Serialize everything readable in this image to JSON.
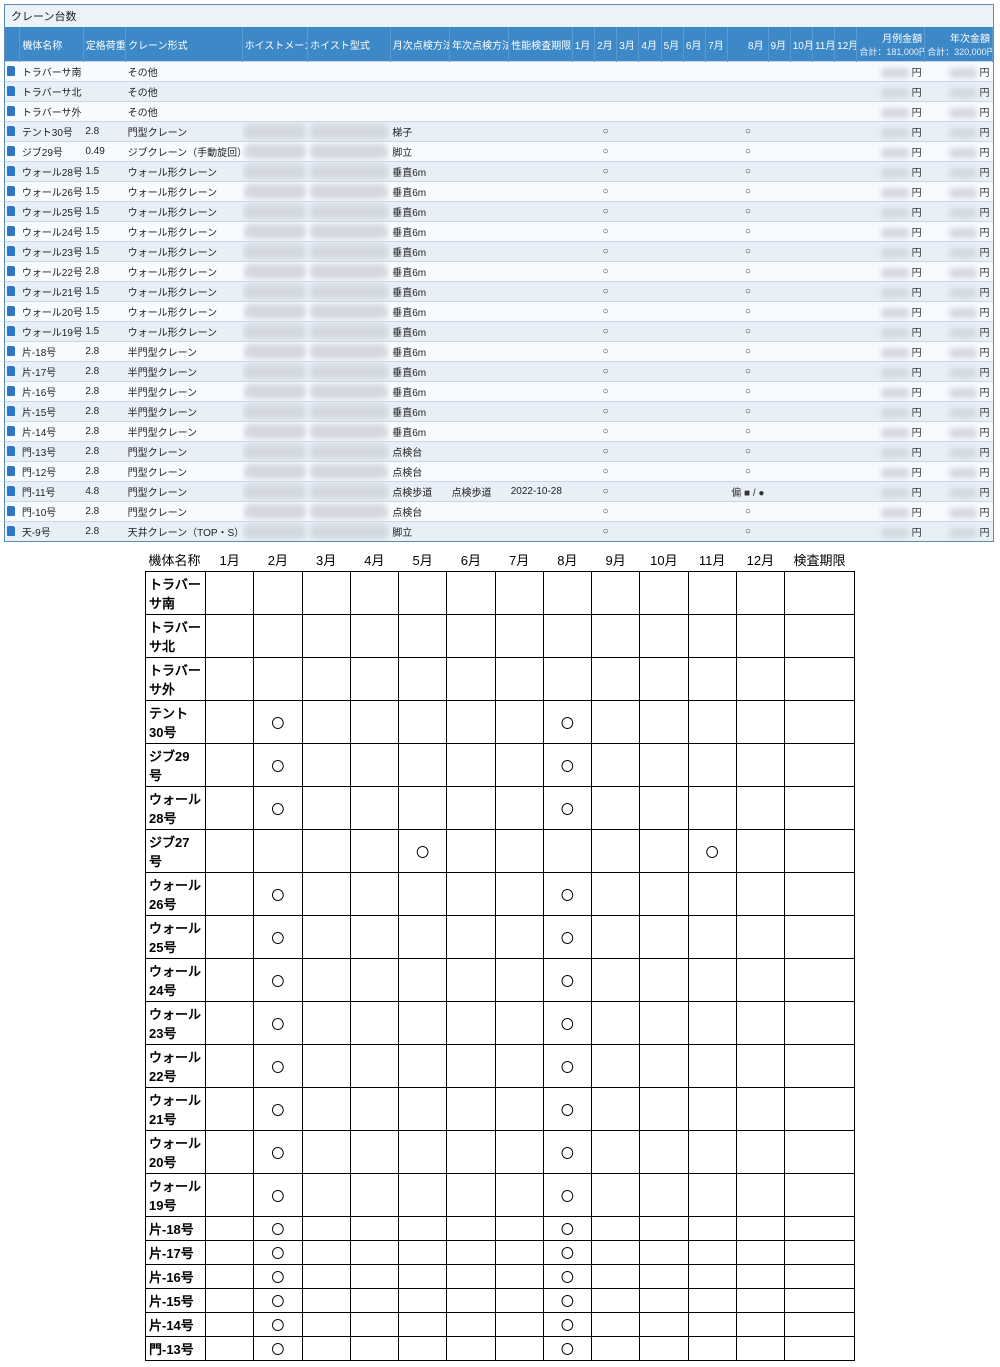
{
  "panel_title": "クレーン台数",
  "headers": {
    "name": "機体名称",
    "load": "定格荷重(t)",
    "type": "クレーン形式",
    "maker": "ホイストメーカー",
    "model": "ホイスト型式",
    "mm": "月次点検方法",
    "ym": "年次点検方法",
    "exp": "性能検査期限",
    "months": [
      "1月",
      "2月",
      "3月",
      "4月",
      "5月",
      "6月",
      "7月",
      "8月",
      "9月",
      "10月",
      "11月",
      "12月"
    ],
    "mfee": "月例金額",
    "mfee_sub": "合計：181,000円",
    "yfee": "年次金額",
    "yfee_sub": "合計：320,000円"
  },
  "yen": "円",
  "mark8": "偏 ■ / ●",
  "rows": [
    {
      "name": "トラバーサ南",
      "load": "",
      "type": "その他",
      "mm": "",
      "feb": 0,
      "aug": ""
    },
    {
      "name": "トラバーサ北",
      "load": "",
      "type": "その他",
      "mm": "",
      "feb": 0,
      "aug": ""
    },
    {
      "name": "トラバーサ外",
      "load": "",
      "type": "その他",
      "mm": "",
      "feb": 0,
      "aug": ""
    },
    {
      "name": "テント30号",
      "load": "2.8",
      "type": "門型クレーン",
      "mm": "梯子",
      "feb": 1,
      "aug": "○"
    },
    {
      "name": "ジブ29号",
      "load": "0.49",
      "type": "ジブクレーン（手動旋回）",
      "mm": "脚立",
      "feb": 1,
      "aug": "○"
    },
    {
      "name": "ウォール28号",
      "load": "1.5",
      "type": "ウォール形クレーン",
      "mm": "垂直6m",
      "feb": 1,
      "aug": "○"
    },
    {
      "name": "ウォール26号",
      "load": "1.5",
      "type": "ウォール形クレーン",
      "mm": "垂直6m",
      "feb": 1,
      "aug": "○"
    },
    {
      "name": "ウォール25号",
      "load": "1.5",
      "type": "ウォール形クレーン",
      "mm": "垂直6m",
      "feb": 1,
      "aug": "○"
    },
    {
      "name": "ウォール24号",
      "load": "1.5",
      "type": "ウォール形クレーン",
      "mm": "垂直6m",
      "feb": 1,
      "aug": "○"
    },
    {
      "name": "ウォール23号",
      "load": "1.5",
      "type": "ウォール形クレーン",
      "mm": "垂直6m",
      "feb": 1,
      "aug": "○"
    },
    {
      "name": "ウォール22号",
      "load": "2.8",
      "type": "ウォール形クレーン",
      "mm": "垂直6m",
      "feb": 1,
      "aug": "○"
    },
    {
      "name": "ウォール21号",
      "load": "1.5",
      "type": "ウォール形クレーン",
      "mm": "垂直6m",
      "feb": 1,
      "aug": "○"
    },
    {
      "name": "ウォール20号",
      "load": "1.5",
      "type": "ウォール形クレーン",
      "mm": "垂直6m",
      "feb": 1,
      "aug": "○"
    },
    {
      "name": "ウォール19号",
      "load": "1.5",
      "type": "ウォール形クレーン",
      "mm": "垂直6m",
      "feb": 1,
      "aug": "○"
    },
    {
      "name": "片-18号",
      "load": "2.8",
      "type": "半門型クレーン",
      "mm": "垂直6m",
      "feb": 1,
      "aug": "○"
    },
    {
      "name": "片-17号",
      "load": "2.8",
      "type": "半門型クレーン",
      "mm": "垂直6m",
      "feb": 1,
      "aug": "○"
    },
    {
      "name": "片-16号",
      "load": "2.8",
      "type": "半門型クレーン",
      "mm": "垂直6m",
      "feb": 1,
      "aug": "○"
    },
    {
      "name": "片-15号",
      "load": "2.8",
      "type": "半門型クレーン",
      "mm": "垂直6m",
      "feb": 1,
      "aug": "○"
    },
    {
      "name": "片-14号",
      "load": "2.8",
      "type": "半門型クレーン",
      "mm": "垂直6m",
      "feb": 1,
      "aug": "○"
    },
    {
      "name": "門-13号",
      "load": "2.8",
      "type": "門型クレーン",
      "mm": "点検台",
      "feb": 1,
      "aug": "○"
    },
    {
      "name": "門-12号",
      "load": "2.8",
      "type": "門型クレーン",
      "mm": "点検台",
      "feb": 1,
      "aug": "○"
    },
    {
      "name": "門-11号",
      "load": "4.8",
      "type": "門型クレーン",
      "mm": "点検歩道",
      "ym": "点検歩道",
      "exp": "2022-10-28",
      "feb": 1,
      "aug": "mark"
    },
    {
      "name": "門-10号",
      "load": "2.8",
      "type": "門型クレーン",
      "mm": "点検台",
      "feb": 1,
      "aug": "○"
    },
    {
      "name": "天-9号",
      "load": "2.8",
      "type": "天井クレーン（TOP・S）",
      "mm": "脚立",
      "feb": 1,
      "aug": "○"
    }
  ],
  "plan_headers": [
    "機体名称",
    "1月",
    "2月",
    "3月",
    "4月",
    "5月",
    "6月",
    "7月",
    "8月",
    "9月",
    "10月",
    "11月",
    "12月",
    "検査期限"
  ],
  "plan_rows": [
    {
      "name": "トラバーサ南",
      "m": [
        0,
        0,
        0,
        0,
        0,
        0,
        0,
        0,
        0,
        0,
        0,
        0
      ]
    },
    {
      "name": "トラバーサ北",
      "m": [
        0,
        0,
        0,
        0,
        0,
        0,
        0,
        0,
        0,
        0,
        0,
        0
      ]
    },
    {
      "name": "トラバーサ外",
      "m": [
        0,
        0,
        0,
        0,
        0,
        0,
        0,
        0,
        0,
        0,
        0,
        0
      ]
    },
    {
      "name": "テント30号",
      "m": [
        0,
        1,
        0,
        0,
        0,
        0,
        0,
        1,
        0,
        0,
        0,
        0
      ]
    },
    {
      "name": "ジブ29号",
      "m": [
        0,
        1,
        0,
        0,
        0,
        0,
        0,
        1,
        0,
        0,
        0,
        0
      ]
    },
    {
      "name": "ウォール28号",
      "m": [
        0,
        1,
        0,
        0,
        0,
        0,
        0,
        1,
        0,
        0,
        0,
        0
      ]
    },
    {
      "name": "ジブ27号",
      "m": [
        0,
        0,
        0,
        0,
        1,
        0,
        0,
        0,
        0,
        0,
        1,
        0
      ]
    },
    {
      "name": "ウォール26号",
      "m": [
        0,
        1,
        0,
        0,
        0,
        0,
        0,
        1,
        0,
        0,
        0,
        0
      ]
    },
    {
      "name": "ウォール25号",
      "m": [
        0,
        1,
        0,
        0,
        0,
        0,
        0,
        1,
        0,
        0,
        0,
        0
      ]
    },
    {
      "name": "ウォール24号",
      "m": [
        0,
        1,
        0,
        0,
        0,
        0,
        0,
        1,
        0,
        0,
        0,
        0
      ]
    },
    {
      "name": "ウォール23号",
      "m": [
        0,
        1,
        0,
        0,
        0,
        0,
        0,
        1,
        0,
        0,
        0,
        0
      ]
    },
    {
      "name": "ウォール22号",
      "m": [
        0,
        1,
        0,
        0,
        0,
        0,
        0,
        1,
        0,
        0,
        0,
        0
      ]
    },
    {
      "name": "ウォール21号",
      "m": [
        0,
        1,
        0,
        0,
        0,
        0,
        0,
        1,
        0,
        0,
        0,
        0
      ]
    },
    {
      "name": "ウォール20号",
      "m": [
        0,
        1,
        0,
        0,
        0,
        0,
        0,
        1,
        0,
        0,
        0,
        0
      ]
    },
    {
      "name": "ウォール19号",
      "m": [
        0,
        1,
        0,
        0,
        0,
        0,
        0,
        1,
        0,
        0,
        0,
        0
      ]
    },
    {
      "name": "片-18号",
      "m": [
        0,
        1,
        0,
        0,
        0,
        0,
        0,
        1,
        0,
        0,
        0,
        0
      ]
    },
    {
      "name": "片-17号",
      "m": [
        0,
        1,
        0,
        0,
        0,
        0,
        0,
        1,
        0,
        0,
        0,
        0
      ]
    },
    {
      "name": "片-16号",
      "m": [
        0,
        1,
        0,
        0,
        0,
        0,
        0,
        1,
        0,
        0,
        0,
        0
      ]
    },
    {
      "name": "片-15号",
      "m": [
        0,
        1,
        0,
        0,
        0,
        0,
        0,
        1,
        0,
        0,
        0,
        0
      ]
    },
    {
      "name": "片-14号",
      "m": [
        0,
        1,
        0,
        0,
        0,
        0,
        0,
        1,
        0,
        0,
        0,
        0
      ]
    },
    {
      "name": "門-13号",
      "m": [
        0,
        1,
        0,
        0,
        0,
        0,
        0,
        1,
        0,
        0,
        0,
        0
      ]
    }
  ],
  "circle": "〇"
}
